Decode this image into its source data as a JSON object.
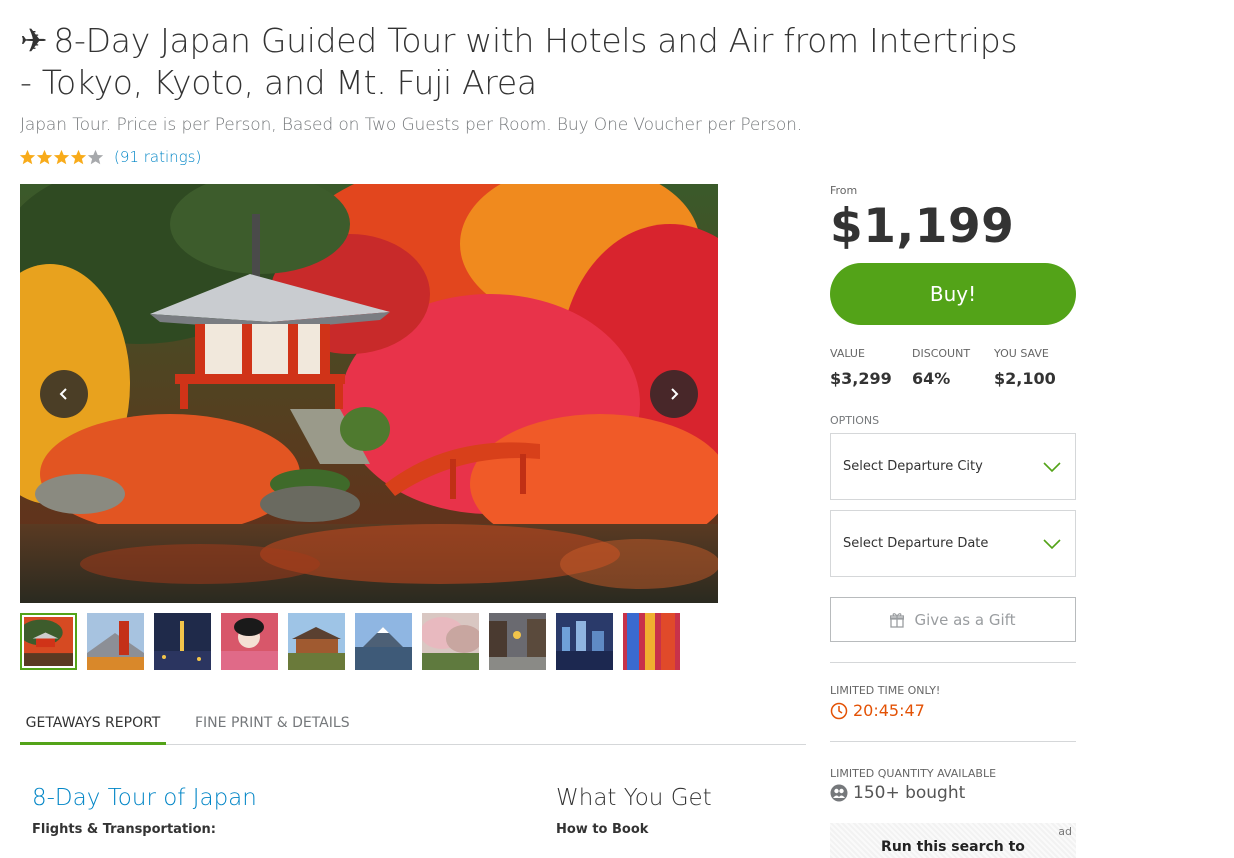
{
  "deal": {
    "title_icon": "airplane-icon",
    "title": "8-Day Japan Guided Tour with Hotels and Air from Intertrips - Tokyo, Kyoto, and Mt. Fuji Area",
    "subtitle": "Japan Tour. Price is per Person, Based on Two Guests per Room. Buy One Voucher per Person.",
    "rating": {
      "stars": 4,
      "max": 5,
      "ratings_text": "(91 ratings)"
    }
  },
  "gallery": {
    "thumbnail_count": 10,
    "active_index": 0
  },
  "tabs": [
    {
      "label": "GETAWAYS REPORT",
      "active": true
    },
    {
      "label": "FINE PRINT & DETAILS",
      "active": false
    }
  ],
  "report": {
    "left_title": "8-Day Tour of Japan",
    "left_subheading": "Flights & Transportation:",
    "right_title": "What You Get",
    "right_subheading": "How to Book"
  },
  "purchase": {
    "from_label": "From",
    "price": "$1,199",
    "buy_label": "Buy!",
    "stats": [
      {
        "label": "VALUE",
        "value": "$3,299"
      },
      {
        "label": "DISCOUNT",
        "value": "64%"
      },
      {
        "label": "YOU SAVE",
        "value": "$2,100"
      }
    ],
    "options_label": "OPTIONS",
    "departure_city": "Select Departure City",
    "departure_date": "Select Departure Date",
    "gift_label": "Give as a Gift",
    "limited_time_label": "LIMITED TIME ONLY!",
    "countdown": "20:45:47",
    "limited_quantity_label": "LIMITED QUANTITY AVAILABLE",
    "bought_text": "150+ bought",
    "ad_tag": "ad",
    "ad_text": "Run this search to"
  },
  "colors": {
    "accent_green": "#53a318",
    "link_blue": "#0185c6",
    "timer_orange": "#e35205",
    "star_gold": "#f8ab1a"
  }
}
